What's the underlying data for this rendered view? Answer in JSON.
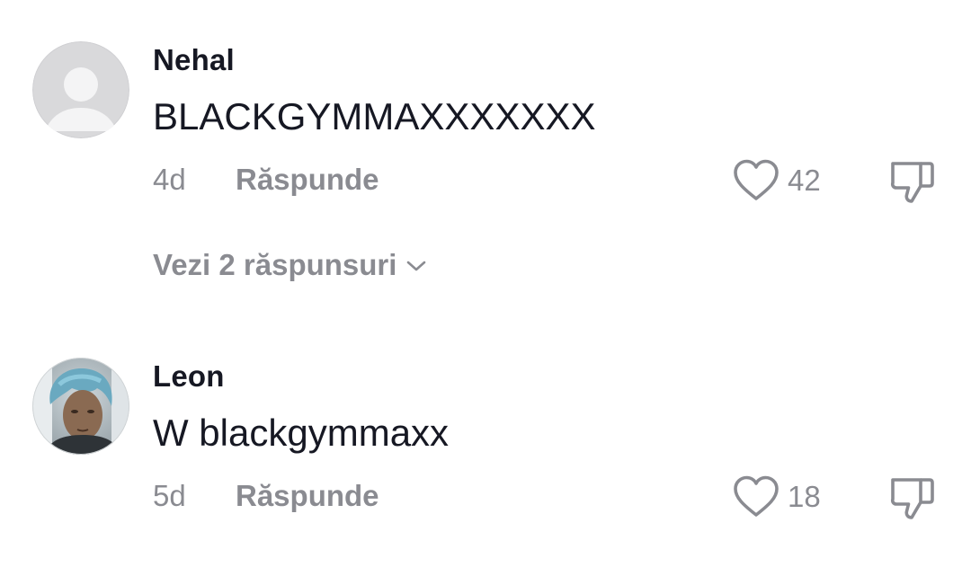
{
  "comments": [
    {
      "username": "Nehal",
      "text": "BLACKGYMMAXXXXXXX",
      "time": "4d",
      "reply_label": "Răspunde",
      "like_count": "42",
      "avatar": "default-avatar",
      "view_replies_label": "Vezi 2 răspunsuri"
    },
    {
      "username": "Leon",
      "text": "W blackgymmaxx",
      "time": "5d",
      "reply_label": "Răspunde",
      "like_count": "18",
      "avatar": "photo-avatar"
    }
  ],
  "icons": {
    "like": "heart-outline-icon",
    "dislike": "thumbs-down-outline-icon",
    "expand": "chevron-down-icon"
  },
  "colors": {
    "primary_text": "#161823",
    "secondary_text": "#8a8b91",
    "avatar_placeholder": "#d7d7d9",
    "background": "#ffffff"
  }
}
